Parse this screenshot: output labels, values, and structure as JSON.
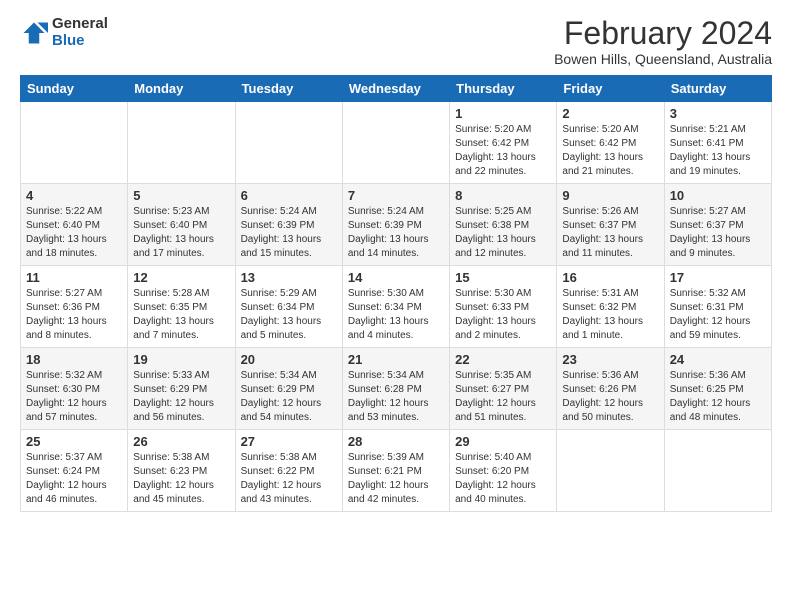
{
  "header": {
    "logo": {
      "general": "General",
      "blue": "Blue"
    },
    "title": "February 2024",
    "subtitle": "Bowen Hills, Queensland, Australia"
  },
  "calendar": {
    "days_of_week": [
      "Sunday",
      "Monday",
      "Tuesday",
      "Wednesday",
      "Thursday",
      "Friday",
      "Saturday"
    ],
    "weeks": [
      [
        {
          "num": "",
          "info": ""
        },
        {
          "num": "",
          "info": ""
        },
        {
          "num": "",
          "info": ""
        },
        {
          "num": "",
          "info": ""
        },
        {
          "num": "1",
          "info": "Sunrise: 5:20 AM\nSunset: 6:42 PM\nDaylight: 13 hours\nand 22 minutes."
        },
        {
          "num": "2",
          "info": "Sunrise: 5:20 AM\nSunset: 6:42 PM\nDaylight: 13 hours\nand 21 minutes."
        },
        {
          "num": "3",
          "info": "Sunrise: 5:21 AM\nSunset: 6:41 PM\nDaylight: 13 hours\nand 19 minutes."
        }
      ],
      [
        {
          "num": "4",
          "info": "Sunrise: 5:22 AM\nSunset: 6:40 PM\nDaylight: 13 hours\nand 18 minutes."
        },
        {
          "num": "5",
          "info": "Sunrise: 5:23 AM\nSunset: 6:40 PM\nDaylight: 13 hours\nand 17 minutes."
        },
        {
          "num": "6",
          "info": "Sunrise: 5:24 AM\nSunset: 6:39 PM\nDaylight: 13 hours\nand 15 minutes."
        },
        {
          "num": "7",
          "info": "Sunrise: 5:24 AM\nSunset: 6:39 PM\nDaylight: 13 hours\nand 14 minutes."
        },
        {
          "num": "8",
          "info": "Sunrise: 5:25 AM\nSunset: 6:38 PM\nDaylight: 13 hours\nand 12 minutes."
        },
        {
          "num": "9",
          "info": "Sunrise: 5:26 AM\nSunset: 6:37 PM\nDaylight: 13 hours\nand 11 minutes."
        },
        {
          "num": "10",
          "info": "Sunrise: 5:27 AM\nSunset: 6:37 PM\nDaylight: 13 hours\nand 9 minutes."
        }
      ],
      [
        {
          "num": "11",
          "info": "Sunrise: 5:27 AM\nSunset: 6:36 PM\nDaylight: 13 hours\nand 8 minutes."
        },
        {
          "num": "12",
          "info": "Sunrise: 5:28 AM\nSunset: 6:35 PM\nDaylight: 13 hours\nand 7 minutes."
        },
        {
          "num": "13",
          "info": "Sunrise: 5:29 AM\nSunset: 6:34 PM\nDaylight: 13 hours\nand 5 minutes."
        },
        {
          "num": "14",
          "info": "Sunrise: 5:30 AM\nSunset: 6:34 PM\nDaylight: 13 hours\nand 4 minutes."
        },
        {
          "num": "15",
          "info": "Sunrise: 5:30 AM\nSunset: 6:33 PM\nDaylight: 13 hours\nand 2 minutes."
        },
        {
          "num": "16",
          "info": "Sunrise: 5:31 AM\nSunset: 6:32 PM\nDaylight: 13 hours\nand 1 minute."
        },
        {
          "num": "17",
          "info": "Sunrise: 5:32 AM\nSunset: 6:31 PM\nDaylight: 12 hours\nand 59 minutes."
        }
      ],
      [
        {
          "num": "18",
          "info": "Sunrise: 5:32 AM\nSunset: 6:30 PM\nDaylight: 12 hours\nand 57 minutes."
        },
        {
          "num": "19",
          "info": "Sunrise: 5:33 AM\nSunset: 6:29 PM\nDaylight: 12 hours\nand 56 minutes."
        },
        {
          "num": "20",
          "info": "Sunrise: 5:34 AM\nSunset: 6:29 PM\nDaylight: 12 hours\nand 54 minutes."
        },
        {
          "num": "21",
          "info": "Sunrise: 5:34 AM\nSunset: 6:28 PM\nDaylight: 12 hours\nand 53 minutes."
        },
        {
          "num": "22",
          "info": "Sunrise: 5:35 AM\nSunset: 6:27 PM\nDaylight: 12 hours\nand 51 minutes."
        },
        {
          "num": "23",
          "info": "Sunrise: 5:36 AM\nSunset: 6:26 PM\nDaylight: 12 hours\nand 50 minutes."
        },
        {
          "num": "24",
          "info": "Sunrise: 5:36 AM\nSunset: 6:25 PM\nDaylight: 12 hours\nand 48 minutes."
        }
      ],
      [
        {
          "num": "25",
          "info": "Sunrise: 5:37 AM\nSunset: 6:24 PM\nDaylight: 12 hours\nand 46 minutes."
        },
        {
          "num": "26",
          "info": "Sunrise: 5:38 AM\nSunset: 6:23 PM\nDaylight: 12 hours\nand 45 minutes."
        },
        {
          "num": "27",
          "info": "Sunrise: 5:38 AM\nSunset: 6:22 PM\nDaylight: 12 hours\nand 43 minutes."
        },
        {
          "num": "28",
          "info": "Sunrise: 5:39 AM\nSunset: 6:21 PM\nDaylight: 12 hours\nand 42 minutes."
        },
        {
          "num": "29",
          "info": "Sunrise: 5:40 AM\nSunset: 6:20 PM\nDaylight: 12 hours\nand 40 minutes."
        },
        {
          "num": "",
          "info": ""
        },
        {
          "num": "",
          "info": ""
        }
      ]
    ]
  }
}
